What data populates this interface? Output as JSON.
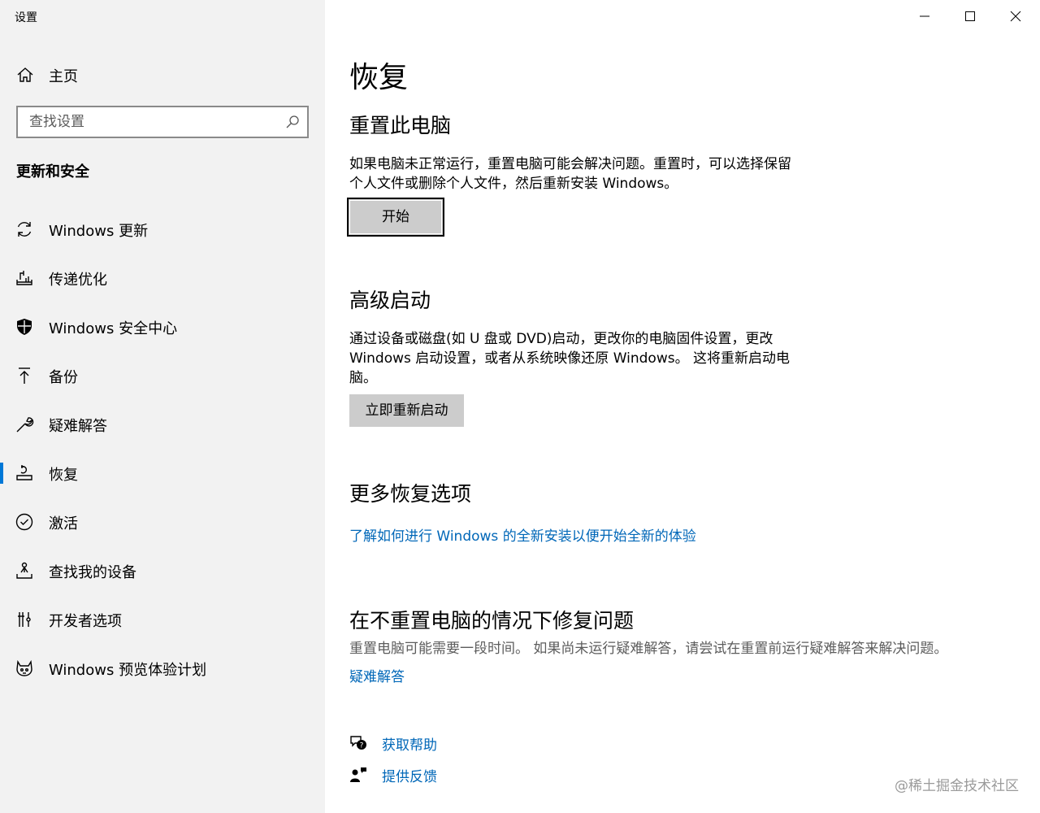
{
  "window": {
    "title": "设置"
  },
  "sidebar": {
    "home_label": "主页",
    "search_placeholder": "查找设置",
    "section_title": "更新和安全",
    "items": [
      {
        "label": "Windows 更新",
        "icon": "refresh-icon"
      },
      {
        "label": "传递优化",
        "icon": "delivery-optimization-icon"
      },
      {
        "label": "Windows 安全中心",
        "icon": "shield-icon"
      },
      {
        "label": "备份",
        "icon": "backup-arrow-icon"
      },
      {
        "label": "疑难解答",
        "icon": "wrench-icon"
      },
      {
        "label": "恢复",
        "icon": "recovery-icon",
        "active": true
      },
      {
        "label": "激活",
        "icon": "check-circle-icon"
      },
      {
        "label": "查找我的设备",
        "icon": "find-device-icon"
      },
      {
        "label": "开发者选项",
        "icon": "developer-tools-icon"
      },
      {
        "label": "Windows 预览体验计划",
        "icon": "insider-cat-icon"
      }
    ]
  },
  "main": {
    "title": "恢复",
    "reset": {
      "heading": "重置此电脑",
      "desc_line1": "如果电脑未正常运行，重置电脑可能会解决问题。重置时，可以选择保留",
      "desc_line2": "个人文件或删除个人文件，然后重新安装 Windows。",
      "button": "开始"
    },
    "advanced": {
      "heading": "高级启动",
      "desc_line1": "通过设备或磁盘(如 U 盘或 DVD)启动，更改你的电脑固件设置，更改",
      "desc_line2": "Windows 启动设置，或者从系统映像还原 Windows。 这将重新启动电",
      "desc_line3": "脑。",
      "button": "立即重新启动"
    },
    "more": {
      "heading": "更多恢复选项",
      "link": "了解如何进行 Windows 的全新安装以便开始全新的体验"
    },
    "fix": {
      "heading": "在不重置电脑的情况下修复问题",
      "desc": "重置电脑可能需要一段时间。 如果尚未运行疑难解答，请尝试在重置前运行疑难解答来解决问题。",
      "link": "疑难解答"
    },
    "help": {
      "get_help": "获取帮助",
      "feedback": "提供反馈"
    }
  },
  "watermark": "@稀土掘金技术社区",
  "colors": {
    "sidebar_bg": "#f2f2f2",
    "accent": "#0078d7",
    "link": "#0067b8",
    "button_bg": "#cccccc"
  }
}
